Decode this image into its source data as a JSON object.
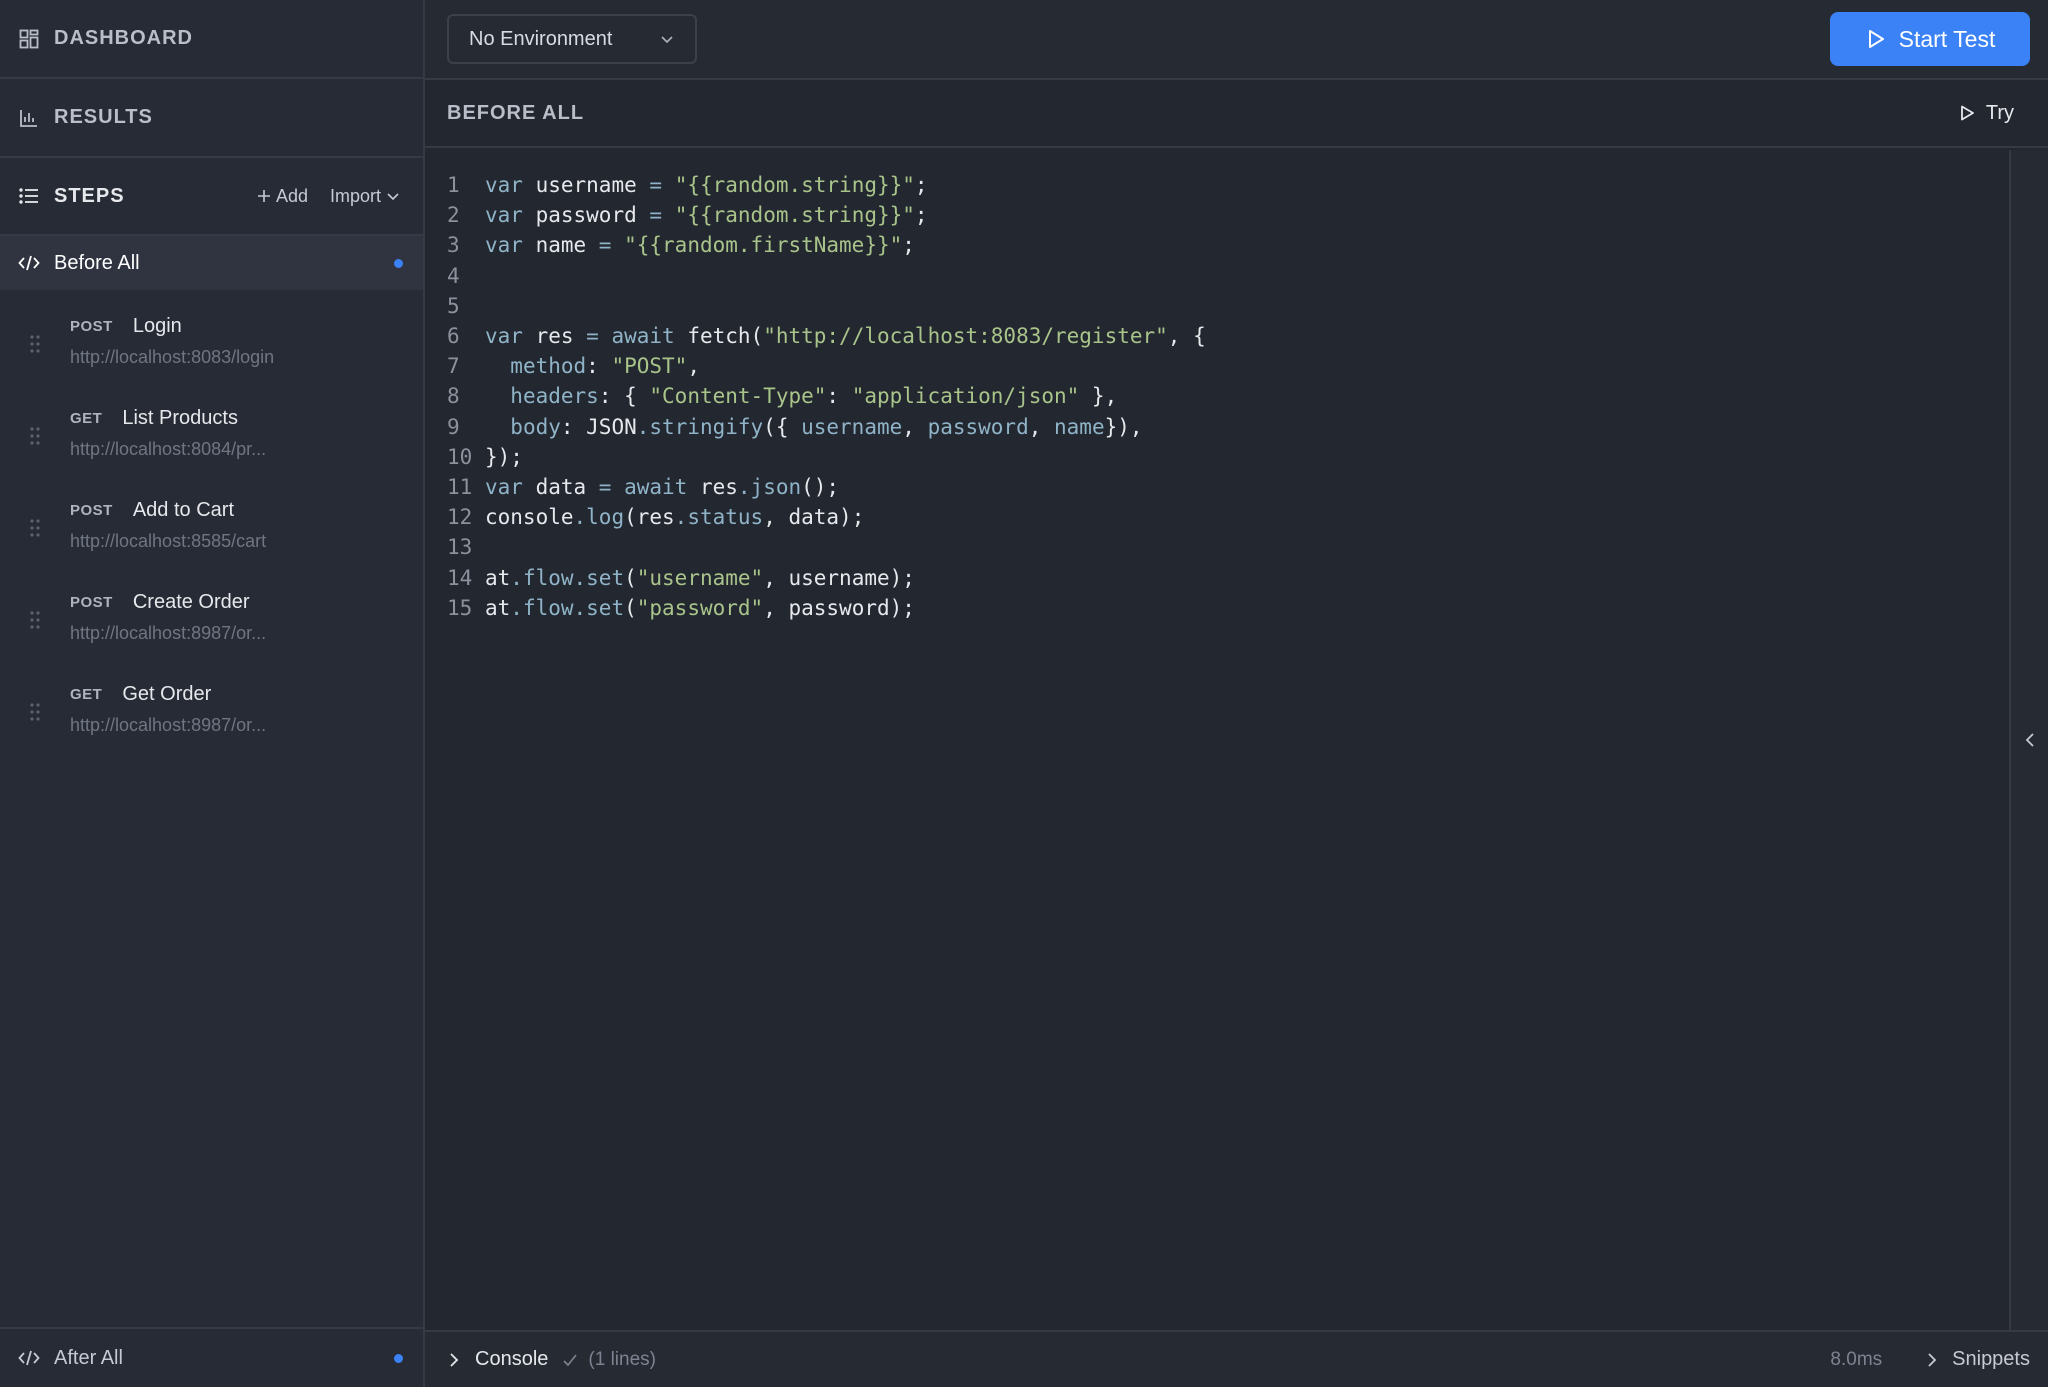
{
  "sidebar": {
    "dashboard_label": "DASHBOARD",
    "results_label": "RESULTS",
    "steps_label": "STEPS",
    "add_label": "Add",
    "import_label": "Import",
    "before_all_label": "Before All",
    "after_all_label": "After All",
    "steps": [
      {
        "method": "POST",
        "name": "Login",
        "url": "http://localhost:8083/login"
      },
      {
        "method": "GET",
        "name": "List Products",
        "url": "http://localhost:8084/pr..."
      },
      {
        "method": "POST",
        "name": "Add to Cart",
        "url": "http://localhost:8585/cart"
      },
      {
        "method": "POST",
        "name": "Create Order",
        "url": "http://localhost:8987/or..."
      },
      {
        "method": "GET",
        "name": "Get Order",
        "url": "http://localhost:8987/or..."
      }
    ]
  },
  "topbar": {
    "environment": "No Environment",
    "start_test_label": "Start Test"
  },
  "section": {
    "title": "BEFORE ALL",
    "try_label": "Try"
  },
  "editor": {
    "line_numbers": [
      "1",
      "2",
      "3",
      "4",
      "5",
      "6",
      "7",
      "8",
      "9",
      "10",
      "11",
      "12",
      "13",
      "14",
      "15"
    ],
    "l1": {
      "a": "var",
      "b": " username ",
      "c": "=",
      "d": " ",
      "e": "\"{{random.string}}\"",
      "f": ";"
    },
    "l2": {
      "a": "var",
      "b": " password ",
      "c": "=",
      "d": " ",
      "e": "\"{{random.string}}\"",
      "f": ";"
    },
    "l3": {
      "a": "var",
      "b": " name ",
      "c": "=",
      "d": " ",
      "e": "\"{{random.firstName}}\"",
      "f": ";"
    },
    "l6": {
      "a": "var",
      "b": " res ",
      "c": "=",
      "d": " ",
      "e": "await",
      "f": " fetch(",
      "g": "\"http://localhost:8083/register\"",
      "h": ", {"
    },
    "l7": {
      "a": "  ",
      "b": "method",
      "c": ": ",
      "d": "\"POST\"",
      "e": ","
    },
    "l8": {
      "a": "  ",
      "b": "headers",
      "c": ": { ",
      "d": "\"Content-Type\"",
      "e": ": ",
      "f": "\"application/json\"",
      "g": " },"
    },
    "l9": {
      "a": "  ",
      "b": "body",
      "c": ": JSON",
      "d": ".stringify",
      "e": "({ ",
      "f": "username",
      "g": ", ",
      "h": "password",
      "i": ", ",
      "j": "name",
      "k": "}),"
    },
    "l10": {
      "a": "});"
    },
    "l11": {
      "a": "var",
      "b": " data ",
      "c": "=",
      "d": " ",
      "e": "await",
      "f": " res",
      "g": ".json",
      "h": "();"
    },
    "l12": {
      "a": "console",
      "b": ".log",
      "c": "(res",
      "d": ".status",
      "e": ", data);"
    },
    "l14": {
      "a": "at",
      "b": ".flow",
      "c": ".set",
      "d": "(",
      "e": "\"username\"",
      "f": ", username);"
    },
    "l15": {
      "a": "at",
      "b": ".flow",
      "c": ".set",
      "d": "(",
      "e": "\"password\"",
      "f": ", password);"
    }
  },
  "console": {
    "label": "Console",
    "lines": "(1 lines)",
    "time": "8.0ms",
    "snippets_label": "Snippets"
  },
  "colors": {
    "accent": "#3b82f6",
    "background": "#232730",
    "sidebar": "#272b35"
  }
}
